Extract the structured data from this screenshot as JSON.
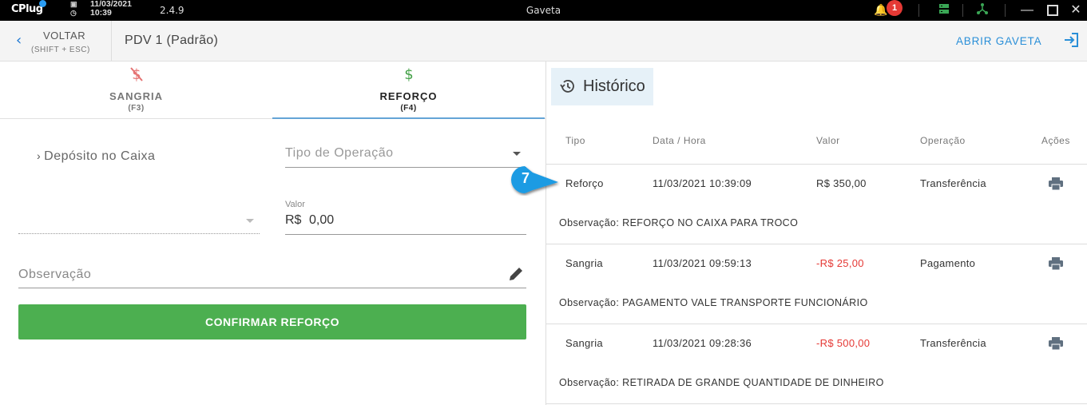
{
  "titlebar": {
    "logo": "CPlug",
    "date": "11/03/2021",
    "time": "10:39",
    "version": "2.4.9",
    "window_title": "Gaveta",
    "notification_count": "1"
  },
  "header": {
    "back_label": "VOLTAR",
    "back_shortcut": "(SHIFT + ESC)",
    "pdv_name": "PDV 1 (Padrão)",
    "open_drawer_label": "ABRIR GAVETA"
  },
  "tabs": [
    {
      "label": "SANGRIA",
      "shortcut": "(F3)"
    },
    {
      "label": "REFORÇO",
      "shortcut": "(F4)"
    }
  ],
  "form": {
    "deposit_label": "Depósito no Caixa",
    "operation_type_placeholder": "Tipo de Operação",
    "value_label": "Valor",
    "currency": "R$",
    "value": "0,00",
    "observation_placeholder": "Observação",
    "confirm_label": "CONFIRMAR REFORÇO"
  },
  "history": {
    "title": "Histórico",
    "columns": [
      "Tipo",
      "Data / Hora",
      "Valor",
      "Operação",
      "Ações"
    ],
    "rows": [
      {
        "tipo": "Reforço",
        "datetime": "11/03/2021 10:39:09",
        "valor": "R$ 350,00",
        "operacao": "Transferência",
        "observacao": "Observação: REFORÇO NO CAIXA PARA TROCO",
        "negative": false
      },
      {
        "tipo": "Sangria",
        "datetime": "11/03/2021 09:59:13",
        "valor": "-R$ 25,00",
        "operacao": "Pagamento",
        "observacao": "Observação: PAGAMENTO VALE TRANSPORTE FUNCIONÁRIO",
        "negative": true
      },
      {
        "tipo": "Sangria",
        "datetime": "11/03/2021 09:28:36",
        "valor": "-R$ 500,00",
        "operacao": "Transferência",
        "observacao": "Observação: RETIRADA DE GRANDE QUANTIDADE DE DINHEIRO",
        "negative": true
      }
    ]
  },
  "callout": {
    "number": "7"
  },
  "colors": {
    "accent": "#2a8fd8",
    "confirm": "#4caf50",
    "negative": "#e53935",
    "sangria_icon": "#e57373",
    "reforco_icon": "#43a047"
  }
}
